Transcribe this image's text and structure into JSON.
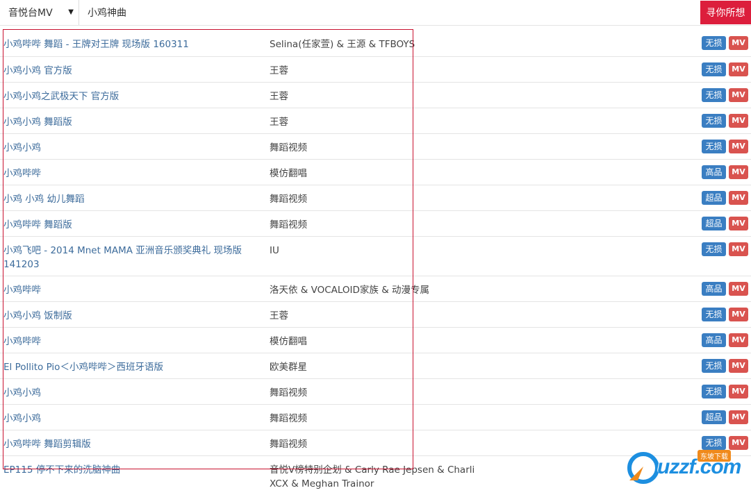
{
  "search": {
    "source": "音悦台MV",
    "query": "小鸡神曲",
    "button_label": "寻你所想"
  },
  "results": [
    {
      "title": "小鸡哔哔 舞蹈 - 王牌对王牌 现场版 160311",
      "artist": "Selina(任家萱) & 王源 & TFBOYS",
      "quality": "无损",
      "mv": "MV"
    },
    {
      "title": "小鸡小鸡 官方版",
      "artist": "王蓉",
      "quality": "无损",
      "mv": "MV"
    },
    {
      "title": "小鸡小鸡之武极天下 官方版",
      "artist": "王蓉",
      "quality": "无损",
      "mv": "MV"
    },
    {
      "title": "小鸡小鸡 舞蹈版",
      "artist": "王蓉",
      "quality": "无损",
      "mv": "MV"
    },
    {
      "title": "小鸡小鸡",
      "artist": "舞蹈视频",
      "quality": "无损",
      "mv": "MV"
    },
    {
      "title": "小鸡哔哔",
      "artist": "模仿翻唱",
      "quality": "高品",
      "mv": "MV"
    },
    {
      "title": "小鸡 小鸡 幼儿舞蹈",
      "artist": "舞蹈视频",
      "quality": "超品",
      "mv": "MV"
    },
    {
      "title": "小鸡哔哔 舞蹈版",
      "artist": "舞蹈视频",
      "quality": "超品",
      "mv": "MV"
    },
    {
      "title": "小鸡飞吧 - 2014 Mnet MAMA 亚洲音乐颁奖典礼 现场版 141203",
      "artist": "IU",
      "quality": "无损",
      "mv": "MV"
    },
    {
      "title": "小鸡哔哔",
      "artist": "洛天依 & VOCALOID家族 & 动漫专属",
      "quality": "高品",
      "mv": "MV"
    },
    {
      "title": "小鸡小鸡 饭制版",
      "artist": "王蓉",
      "quality": "无损",
      "mv": "MV"
    },
    {
      "title": "小鸡哔哔",
      "artist": "模仿翻唱",
      "quality": "高品",
      "mv": "MV"
    },
    {
      "title": "El Pollito Pio＜小鸡哔哔＞西班牙语版",
      "artist": "欧美群星",
      "quality": "无损",
      "mv": "MV"
    },
    {
      "title": "小鸡小鸡",
      "artist": "舞蹈视频",
      "quality": "无损",
      "mv": "MV"
    },
    {
      "title": "小鸡小鸡",
      "artist": "舞蹈视频",
      "quality": "超品",
      "mv": "MV"
    },
    {
      "title": "小鸡哔哔 舞蹈剪辑版",
      "artist": "舞蹈视频",
      "quality": "无损",
      "mv": "MV"
    },
    {
      "title": "EP115 停不下来的洗脑神曲",
      "artist": "音悦V榜特别企划 & Carly Rae Jepsen & Charli XCX & Meghan Trainor",
      "quality": "",
      "mv": ""
    }
  ],
  "watermark": {
    "text": "uzzf.com",
    "sub": "东坡下载"
  }
}
